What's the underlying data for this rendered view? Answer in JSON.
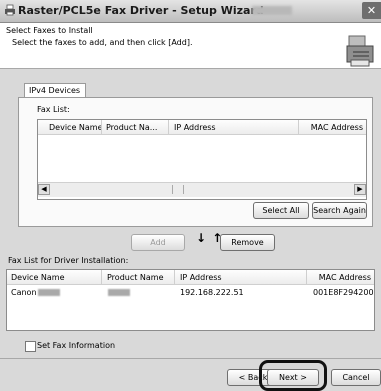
{
  "window": {
    "title": "Raster/PCL5e Fax Driver - Setup Wizard",
    "close_glyph": "✕"
  },
  "header": {
    "title": "Select Faxes to Install",
    "subtitle": "Select the faxes to add, and then click [Add]."
  },
  "tabs": [
    {
      "label": "IPv4 Devices"
    }
  ],
  "fax_list": {
    "label": "Fax List:",
    "columns": [
      "Device Name",
      "Product Na...",
      "IP Address",
      "MAC Address"
    ],
    "rows": []
  },
  "buttons": {
    "select_all": "Select All",
    "search_again": "Search Again",
    "add": "Add",
    "remove": "Remove",
    "back": "< Back",
    "next": "Next >",
    "cancel": "Cancel"
  },
  "move_arrows": "↓ ↑",
  "install_list": {
    "label": "Fax List for Driver Installation:",
    "columns": [
      "Device Name",
      "Product Name",
      "IP Address",
      "MAC Address"
    ],
    "rows": [
      {
        "device_name": "Canon",
        "product_name": "",
        "ip_address": "192.168.222.51",
        "mac_address": "001E8F294200"
      }
    ]
  },
  "set_fax_information": {
    "label": "Set Fax Information",
    "checked": false
  },
  "icons": [
    "printer-icon",
    "wizard-printer-graphic",
    "close-icon",
    "scroll-left-icon",
    "scroll-right-icon",
    "down-arrow-icon",
    "up-arrow-icon"
  ]
}
